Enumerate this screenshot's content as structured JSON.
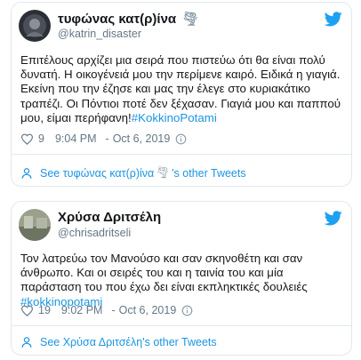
{
  "colors": {
    "accent": "#1b95e0",
    "muted": "#657786",
    "border": "#e1e8ed",
    "twitter_blue": "#1da1f2"
  },
  "tweets": [
    {
      "name": "τυφώνας κατ(ρ)ίνα",
      "name_emoji": "🌪",
      "handle": "@katrin_disaster",
      "text": "Επιτέλους αρχίζει μια σειρά που πιστεύω ότι θα είναι πολύ δυνατή. Η οικογένειά μου την περίμενε καιρό. Ειδικά η γιαγιά. Εκείνη που την έζησε και μας την έλεγε στο κυριακάτικο τραπέζι. Οι Πόντιοι ποτέ δεν ξέχασαν. Γιαγιά μου και παππού μου, είμαι περήφανη!",
      "hashtag": "#KokkinoPotami",
      "likes": "9",
      "time": "9:04 PM",
      "separator": "-",
      "date": "Oct 6, 2019",
      "footer_prefix": "See τυφώνας κατ(ρ)ίνα",
      "footer_suffix": "'s other Tweets",
      "icons": {
        "like": "heart-icon",
        "info": "info-icon",
        "profile": "profile-icon",
        "logo": "twitter-bird-icon"
      }
    },
    {
      "name": "Χρύσα Δριτσέλη",
      "handle": "@chrisadritseli",
      "text": "Τον λατρεύω τον Μανούσο και σαν σκηνοθέτη και σαν άνθρωπο. Και οι σειρές του και η ταινία του και μία παράσταση του που έχω δει είναι εκπληκτικές δουλειές",
      "hashtag": "#kokkinopotami",
      "likes": "19",
      "time": "9:02 PM",
      "separator": "-",
      "date": "Oct 6, 2019",
      "footer_text": "See Χρύσα Δριτσέλη's other Tweets",
      "icons": {
        "like": "heart-icon",
        "info": "info-icon",
        "profile": "profile-icon",
        "logo": "twitter-bird-icon"
      }
    }
  ]
}
